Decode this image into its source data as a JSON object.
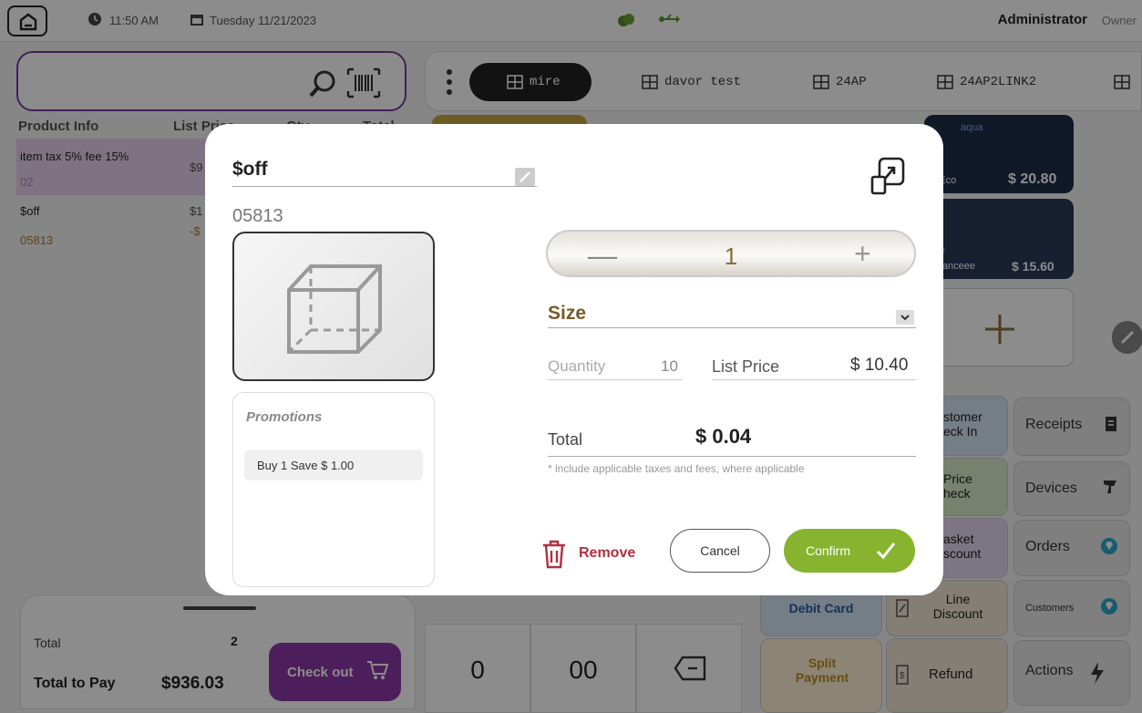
{
  "topbar": {
    "time": "11:50 AM",
    "date": "Tuesday 11/21/2023",
    "user": "Administrator",
    "role": "Owner"
  },
  "cart": {
    "columns": [
      "Product Info",
      "List Price",
      "Qty",
      "Total"
    ],
    "items": [
      {
        "name": "item tax 5% fee 15%",
        "code": "02",
        "price": "$9"
      },
      {
        "name": "$off",
        "code": "05813",
        "price": "$1",
        "discount": "-$"
      }
    ],
    "total_label": "Total",
    "total_qty": "2",
    "total_to_pay_label": "Total to Pay",
    "total_to_pay": "$936.03",
    "checkout_label": "Check out"
  },
  "profiles": {
    "tabs": [
      "mire",
      "davor test",
      "24AP",
      "24AP2LINK2"
    ]
  },
  "tiles": {
    "tile1_name": "uaEco",
    "tile1_price": "$ 20.80",
    "tile1_brand": "aqua",
    "tile2_name": "duranceee",
    "tile2_prefix": "lette",
    "tile2_price": "$ 15.60"
  },
  "function_buttons": {
    "customer_checkin": "stomer\neck In",
    "price_check": "Price\nheck",
    "basket_discount": "asket\nscount",
    "debit_card": "Debit Card",
    "line_discount": "Line Discount",
    "split_payment": "Split Payment",
    "refund": "Refund"
  },
  "side_buttons": {
    "receipts": "Receipts",
    "devices": "Devices",
    "orders": "Orders",
    "customers": "Customers",
    "actions": "Actions"
  },
  "keypad": {
    "zero": "0",
    "double_zero": "00"
  },
  "modal": {
    "title": "$off",
    "sku": "05813",
    "promotions_title": "Promotions",
    "promotions": [
      "Buy 1 Save $ 1.00"
    ],
    "quantity_value": "1",
    "size_label": "Size",
    "quantity_label": "Quantity",
    "quantity_stock": "10",
    "list_price_label": "List Price",
    "list_price_value": "$ 10.40",
    "total_label": "Total",
    "total_value": "$ 0.04",
    "total_note": "* include applicable taxes and fees, where applicable",
    "remove_label": "Remove",
    "cancel_label": "Cancel",
    "confirm_label": "Confirm"
  },
  "colors": {
    "accent_purple": "#8a3aa8",
    "confirm_green": "#86b42e",
    "remove_red": "#b03040",
    "size_brown": "#7a5a2a"
  }
}
